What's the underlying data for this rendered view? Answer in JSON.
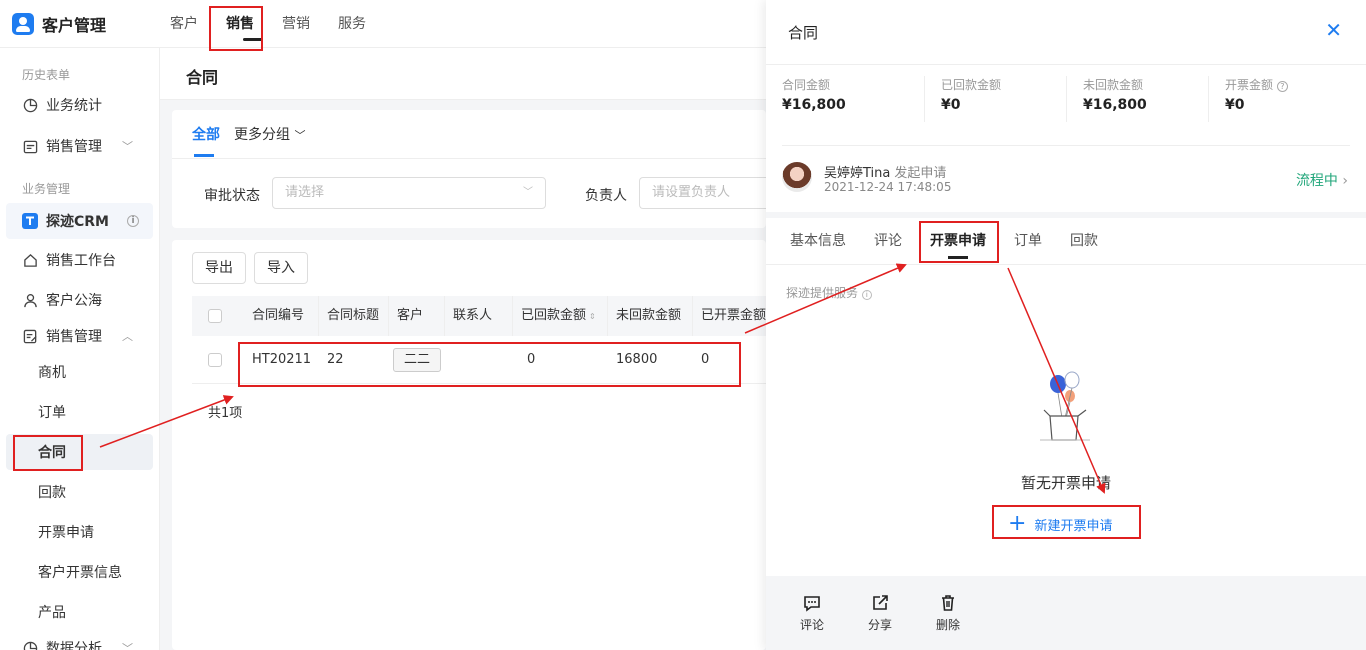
{
  "app": {
    "title": "客户管理"
  },
  "topnav": [
    "客户",
    "销售",
    "营销",
    "服务"
  ],
  "sidebar": {
    "section_history": "历史表单",
    "history_items": [
      "业务统计",
      "销售管理"
    ],
    "section_business": "业务管理",
    "brand": "探迹CRM",
    "items": [
      "销售工作台",
      "客户公海",
      "销售管理"
    ],
    "sub_items": [
      "商机",
      "订单",
      "合同",
      "回款",
      "开票申请",
      "客户开票信息",
      "产品"
    ],
    "bottom": "数据分析"
  },
  "page": {
    "title": "合同",
    "tab_all": "全部",
    "tab_more": "更多分组",
    "filter_status_label": "审批状态",
    "filter_status_placeholder": "请选择",
    "filter_owner_label": "负责人",
    "filter_owner_placeholder": "请设置负责人",
    "export_label": "导出",
    "import_label": "导入",
    "columns": [
      "合同编号",
      "合同标题",
      "客户",
      "联系人",
      "已回款金额",
      "未回款金额",
      "已开票金额"
    ],
    "row": {
      "id": "HT20211",
      "title": "22",
      "customer": "二二",
      "contact": "",
      "received": "0",
      "unreceived": "16800",
      "invoiced": "0"
    },
    "total": "共1项"
  },
  "drawer": {
    "title": "合同",
    "stats": [
      {
        "label": "合同金额",
        "value": "¥16,800"
      },
      {
        "label": "已回款金额",
        "value": "¥0"
      },
      {
        "label": "未回款金额",
        "value": "¥16,800"
      },
      {
        "label": "开票金额",
        "value": "¥0"
      }
    ],
    "applicant_name": "吴婷婷Tina",
    "applicant_action": "发起申请",
    "applicant_time": "2021-12-24 17:48:05",
    "flow_status": "流程中",
    "tabs": [
      "基本信息",
      "评论",
      "开票申请",
      "订单",
      "回款"
    ],
    "provider": "探迹提供服务",
    "empty_text": "暂无开票申请",
    "new_label": "新建开票申请",
    "footer": [
      "评论",
      "分享",
      "删除"
    ]
  },
  "colors": {
    "accent": "#1e7cf0",
    "success": "#21a67a",
    "annotation": "#e02020"
  }
}
